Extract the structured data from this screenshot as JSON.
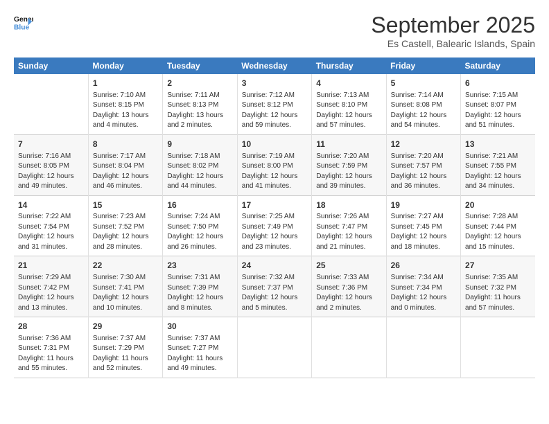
{
  "header": {
    "logo_line1": "General",
    "logo_line2": "Blue",
    "month": "September 2025",
    "location": "Es Castell, Balearic Islands, Spain"
  },
  "days_of_week": [
    "Sunday",
    "Monday",
    "Tuesday",
    "Wednesday",
    "Thursday",
    "Friday",
    "Saturday"
  ],
  "weeks": [
    [
      {
        "day": "",
        "text": ""
      },
      {
        "day": "1",
        "text": "Sunrise: 7:10 AM\nSunset: 8:15 PM\nDaylight: 13 hours\nand 4 minutes."
      },
      {
        "day": "2",
        "text": "Sunrise: 7:11 AM\nSunset: 8:13 PM\nDaylight: 13 hours\nand 2 minutes."
      },
      {
        "day": "3",
        "text": "Sunrise: 7:12 AM\nSunset: 8:12 PM\nDaylight: 12 hours\nand 59 minutes."
      },
      {
        "day": "4",
        "text": "Sunrise: 7:13 AM\nSunset: 8:10 PM\nDaylight: 12 hours\nand 57 minutes."
      },
      {
        "day": "5",
        "text": "Sunrise: 7:14 AM\nSunset: 8:08 PM\nDaylight: 12 hours\nand 54 minutes."
      },
      {
        "day": "6",
        "text": "Sunrise: 7:15 AM\nSunset: 8:07 PM\nDaylight: 12 hours\nand 51 minutes."
      }
    ],
    [
      {
        "day": "7",
        "text": "Sunrise: 7:16 AM\nSunset: 8:05 PM\nDaylight: 12 hours\nand 49 minutes."
      },
      {
        "day": "8",
        "text": "Sunrise: 7:17 AM\nSunset: 8:04 PM\nDaylight: 12 hours\nand 46 minutes."
      },
      {
        "day": "9",
        "text": "Sunrise: 7:18 AM\nSunset: 8:02 PM\nDaylight: 12 hours\nand 44 minutes."
      },
      {
        "day": "10",
        "text": "Sunrise: 7:19 AM\nSunset: 8:00 PM\nDaylight: 12 hours\nand 41 minutes."
      },
      {
        "day": "11",
        "text": "Sunrise: 7:20 AM\nSunset: 7:59 PM\nDaylight: 12 hours\nand 39 minutes."
      },
      {
        "day": "12",
        "text": "Sunrise: 7:20 AM\nSunset: 7:57 PM\nDaylight: 12 hours\nand 36 minutes."
      },
      {
        "day": "13",
        "text": "Sunrise: 7:21 AM\nSunset: 7:55 PM\nDaylight: 12 hours\nand 34 minutes."
      }
    ],
    [
      {
        "day": "14",
        "text": "Sunrise: 7:22 AM\nSunset: 7:54 PM\nDaylight: 12 hours\nand 31 minutes."
      },
      {
        "day": "15",
        "text": "Sunrise: 7:23 AM\nSunset: 7:52 PM\nDaylight: 12 hours\nand 28 minutes."
      },
      {
        "day": "16",
        "text": "Sunrise: 7:24 AM\nSunset: 7:50 PM\nDaylight: 12 hours\nand 26 minutes."
      },
      {
        "day": "17",
        "text": "Sunrise: 7:25 AM\nSunset: 7:49 PM\nDaylight: 12 hours\nand 23 minutes."
      },
      {
        "day": "18",
        "text": "Sunrise: 7:26 AM\nSunset: 7:47 PM\nDaylight: 12 hours\nand 21 minutes."
      },
      {
        "day": "19",
        "text": "Sunrise: 7:27 AM\nSunset: 7:45 PM\nDaylight: 12 hours\nand 18 minutes."
      },
      {
        "day": "20",
        "text": "Sunrise: 7:28 AM\nSunset: 7:44 PM\nDaylight: 12 hours\nand 15 minutes."
      }
    ],
    [
      {
        "day": "21",
        "text": "Sunrise: 7:29 AM\nSunset: 7:42 PM\nDaylight: 12 hours\nand 13 minutes."
      },
      {
        "day": "22",
        "text": "Sunrise: 7:30 AM\nSunset: 7:41 PM\nDaylight: 12 hours\nand 10 minutes."
      },
      {
        "day": "23",
        "text": "Sunrise: 7:31 AM\nSunset: 7:39 PM\nDaylight: 12 hours\nand 8 minutes."
      },
      {
        "day": "24",
        "text": "Sunrise: 7:32 AM\nSunset: 7:37 PM\nDaylight: 12 hours\nand 5 minutes."
      },
      {
        "day": "25",
        "text": "Sunrise: 7:33 AM\nSunset: 7:36 PM\nDaylight: 12 hours\nand 2 minutes."
      },
      {
        "day": "26",
        "text": "Sunrise: 7:34 AM\nSunset: 7:34 PM\nDaylight: 12 hours\nand 0 minutes."
      },
      {
        "day": "27",
        "text": "Sunrise: 7:35 AM\nSunset: 7:32 PM\nDaylight: 11 hours\nand 57 minutes."
      }
    ],
    [
      {
        "day": "28",
        "text": "Sunrise: 7:36 AM\nSunset: 7:31 PM\nDaylight: 11 hours\nand 55 minutes."
      },
      {
        "day": "29",
        "text": "Sunrise: 7:37 AM\nSunset: 7:29 PM\nDaylight: 11 hours\nand 52 minutes."
      },
      {
        "day": "30",
        "text": "Sunrise: 7:37 AM\nSunset: 7:27 PM\nDaylight: 11 hours\nand 49 minutes."
      },
      {
        "day": "",
        "text": ""
      },
      {
        "day": "",
        "text": ""
      },
      {
        "day": "",
        "text": ""
      },
      {
        "day": "",
        "text": ""
      }
    ]
  ]
}
